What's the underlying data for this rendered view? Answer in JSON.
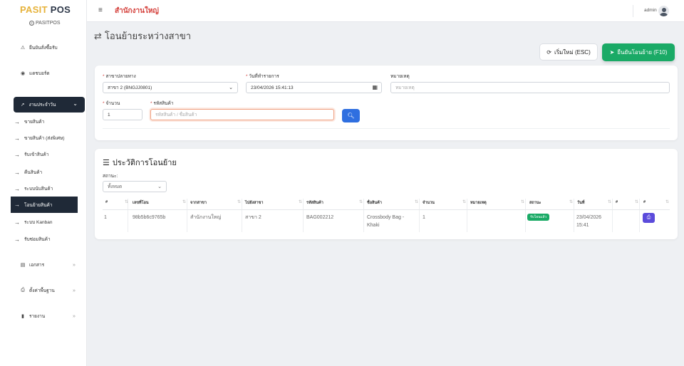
{
  "brand": {
    "part1": "PASIT",
    "part2": "POS",
    "sub": "PASITPOS"
  },
  "sidebar": {
    "items_top": [
      {
        "label": "ยืนยันสั่งซื้อรับ",
        "icon": "warning-icon"
      },
      {
        "label": "แดชบอร์ด",
        "icon": "dashboard-icon"
      }
    ],
    "group": {
      "label": "งานประจำวัน",
      "icon": "chart-line-icon"
    },
    "sub_items": [
      "ขายสินค้า",
      "ขายสินค้า (ส่งพิเศษ)",
      "รับเข้าสินค้า",
      "คืนสินค้า",
      "ระบบนับสินค้า",
      "โอนย้ายสินค้า",
      "ระบบ Kanban",
      "รับซ่อมสินค้า"
    ],
    "active_sub": "โอนย้ายสินค้า",
    "items_bottom": [
      {
        "label": "เอกสาร",
        "icon": "document-icon"
      },
      {
        "label": "ตั้งค่าพื้นฐาน",
        "icon": "printer-icon"
      },
      {
        "label": "รายงาน",
        "icon": "bookmark-icon"
      }
    ]
  },
  "topbar": {
    "branch": "สำนักงานใหญ่",
    "user": "admin"
  },
  "page": {
    "title": "โอนย้ายระหว่างสาขา",
    "reset_button": "เริ่มใหม่ (ESC)",
    "confirm_button": "ยืนยันโอนย้าย (F10)"
  },
  "form": {
    "dest_branch_label": "สาขาปลายทาง",
    "dest_branch_value": "สาขา 2 (BNGJJ0801)",
    "date_label": "วันที่ทำรายการ",
    "date_value": "23/04/2026 15:41:13",
    "note_label": "หมายเหตุ",
    "note_placeholder": "หมายเหตุ",
    "qty_label": "จำนวน",
    "qty_value": "1",
    "code_label": "รหัสสินค้า",
    "code_placeholder": "รหัสสินค้า / ชื่อสินค้า"
  },
  "history": {
    "title": "ประวัติการโอนย้าย",
    "status_label": "สถานะ:",
    "status_value": "ทั้งหมด",
    "columns": [
      "#",
      "เลขที่โอน",
      "จากสาขา",
      "ไปยังสาขา",
      "รหัสสินค้า",
      "ชื่อสินค้า",
      "จำนวน",
      "หมายเหตุ",
      "สถานะ",
      "วันที่",
      "#",
      "#"
    ],
    "rows": [
      {
        "no": "1",
        "transfer_no": "98b5b6c9765b",
        "from": "สำนักงานใหญ่",
        "to": "สาขา 2",
        "code": "BAG002212",
        "name": "Crossbody Bag - Khaki",
        "qty": "1",
        "note": "",
        "status": "รับโอนแล้ว",
        "date": "23/04/2026 15:41"
      }
    ]
  },
  "colors": {
    "accent_green": "#1aaa66",
    "accent_blue": "#2f6fe0",
    "sidebar_dark": "#1f2937",
    "brand_yellow": "#e6b23a",
    "branch_red": "#d43f3a",
    "print_purple": "#5b4bdb"
  }
}
